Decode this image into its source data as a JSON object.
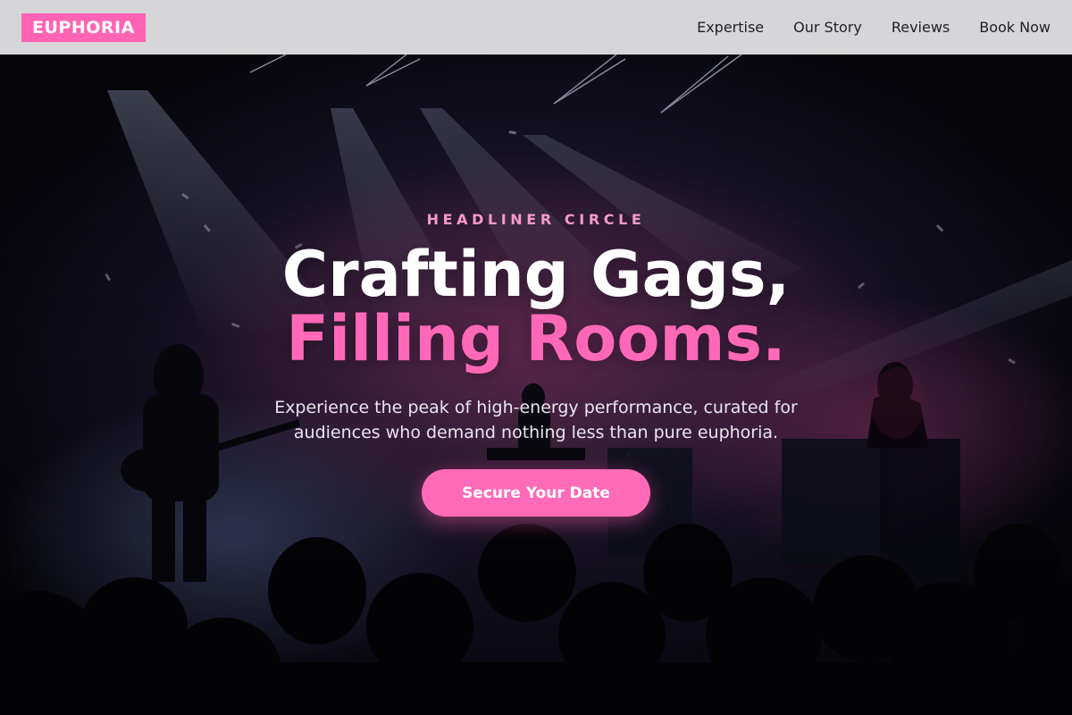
{
  "brand": {
    "logo_text": "EUPHORIA",
    "accent_color": "#ff64b4"
  },
  "nav": {
    "items": [
      {
        "label": "Expertise"
      },
      {
        "label": "Our Story"
      },
      {
        "label": "Reviews"
      },
      {
        "label": "Book Now"
      }
    ]
  },
  "hero": {
    "eyebrow": "HEADLINER CIRCLE",
    "headline_line1": "Crafting Gags,",
    "headline_line2": "Filling Rooms.",
    "subtext": "Experience the peak of high-energy performance, curated for audiences who demand nothing less than pure euphoria.",
    "cta_label": "Secure Your Date",
    "background": "concert-stage-photo"
  }
}
